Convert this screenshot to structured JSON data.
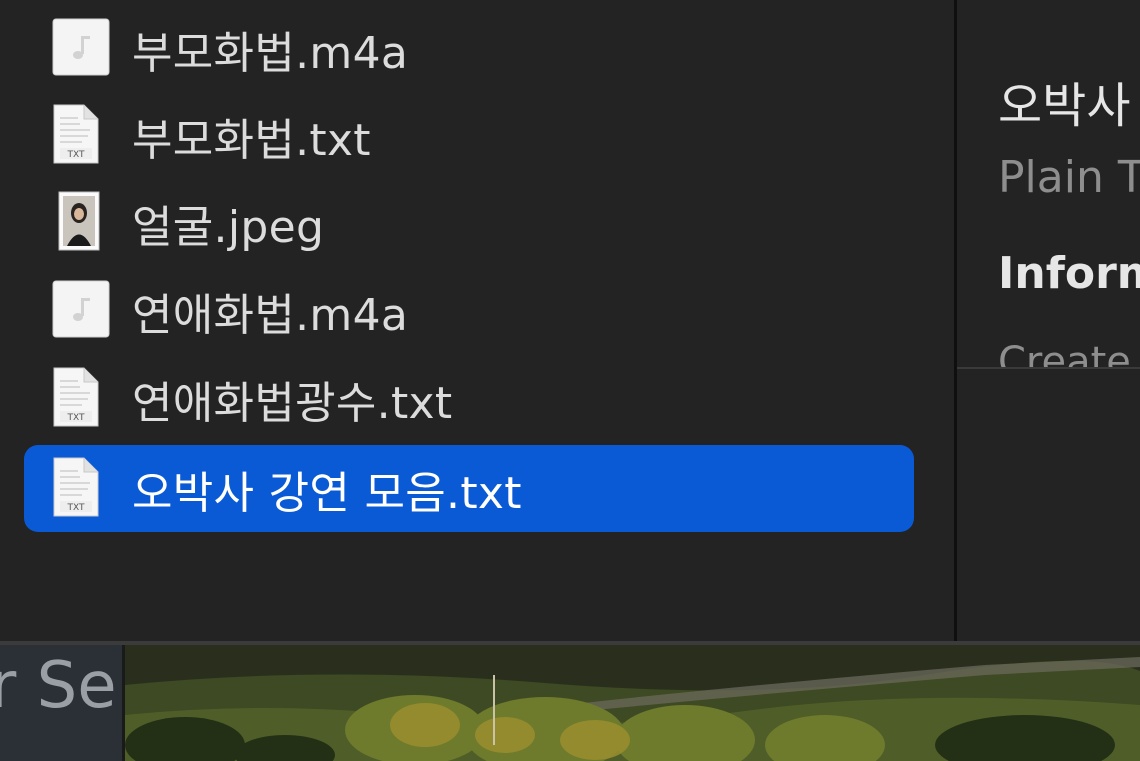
{
  "files": [
    {
      "name": "부모화법.m4a",
      "icon": "audio-file-icon",
      "selected": false
    },
    {
      "name": "부모화법.txt",
      "icon": "text-file-icon",
      "selected": false
    },
    {
      "name": "얼굴.jpeg",
      "icon": "image-file-icon",
      "selected": false
    },
    {
      "name": "연애화법.m4a",
      "icon": "audio-file-icon",
      "selected": false
    },
    {
      "name": "연애화법광수.txt",
      "icon": "text-file-icon",
      "selected": false
    },
    {
      "name": "오박사 강연 모음.txt",
      "icon": "text-file-icon",
      "selected": true
    }
  ],
  "preview": {
    "title": "오박사",
    "kind": "Plain T",
    "info_header": "Inform",
    "created_label": "Create"
  },
  "background_app": {
    "text": "r Se"
  },
  "colors": {
    "selection": "#0a5ad6",
    "window_bg": "#232323",
    "text_primary": "#dcdcdc",
    "text_secondary": "#8e8e8e"
  }
}
